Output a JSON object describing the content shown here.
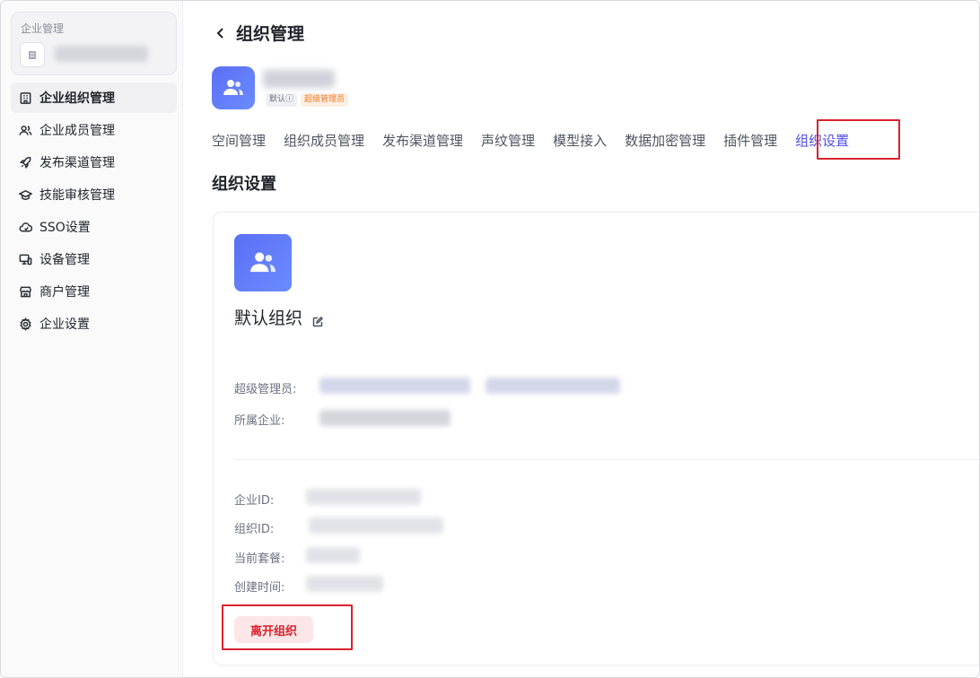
{
  "sidebar": {
    "enterprise_label": "企业管理",
    "items": [
      {
        "label": "企业组织管理",
        "icon": "building-icon",
        "active": true
      },
      {
        "label": "企业成员管理",
        "icon": "users-icon",
        "active": false
      },
      {
        "label": "发布渠道管理",
        "icon": "rocket-icon",
        "active": false
      },
      {
        "label": "技能审核管理",
        "icon": "graduation-cap-icon",
        "active": false
      },
      {
        "label": "SSO设置",
        "icon": "cloud-icon",
        "active": false
      },
      {
        "label": "设备管理",
        "icon": "devices-icon",
        "active": false
      },
      {
        "label": "商户管理",
        "icon": "store-icon",
        "active": false
      },
      {
        "label": "企业设置",
        "icon": "gear-icon",
        "active": false
      }
    ]
  },
  "header": {
    "title": "组织管理",
    "tag_default": "默认ⓘ",
    "tag_admin": "超级管理员"
  },
  "tabs": [
    {
      "label": "空间管理",
      "active": false
    },
    {
      "label": "组织成员管理",
      "active": false
    },
    {
      "label": "发布渠道管理",
      "active": false
    },
    {
      "label": "声纹管理",
      "active": false
    },
    {
      "label": "模型接入",
      "active": false
    },
    {
      "label": "数据加密管理",
      "active": false
    },
    {
      "label": "插件管理",
      "active": false
    },
    {
      "label": "组织设置",
      "active": true
    }
  ],
  "section_title": "组织设置",
  "org_card": {
    "name": "默认组织",
    "super_admin_label": "超级管理员:",
    "enterprise_label": "所属企业:",
    "enterprise_id_label": "企业ID:",
    "org_id_label": "组织ID:",
    "plan_label": "当前套餐:",
    "created_label": "创建时间:",
    "leave_button": "离开组织"
  },
  "colors": {
    "accent": "#4f4ee6",
    "danger": "#d9232e",
    "avatar_gradient_start": "#5b6ff5",
    "avatar_gradient_end": "#6a8cff"
  }
}
